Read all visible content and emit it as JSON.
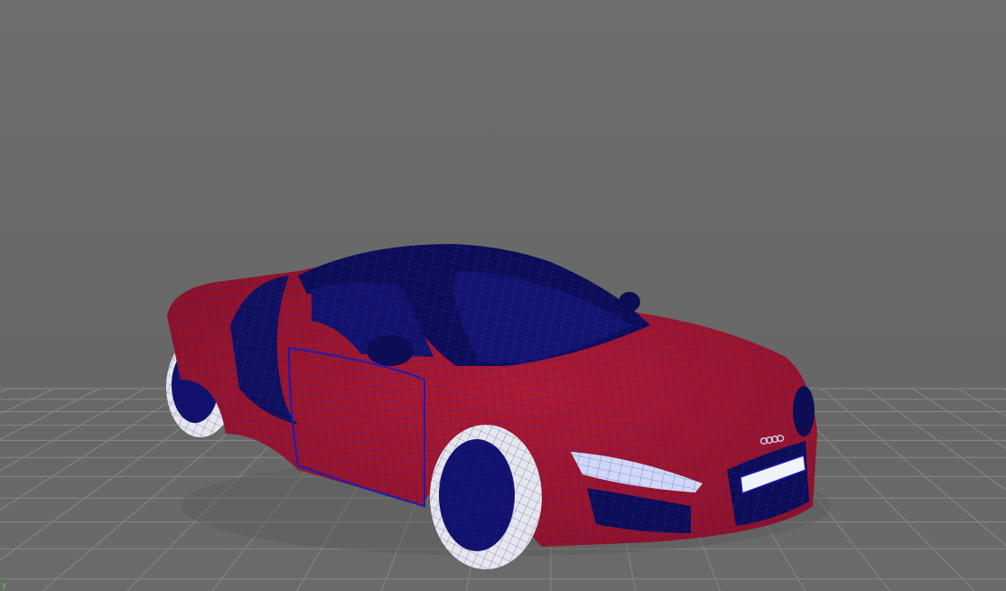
{
  "viewport": {
    "background_color": "#6b6b6b",
    "grid_color": "#8c8c8c",
    "model_base_color": "#a3172c",
    "wireframe_color": "#1c1cb0",
    "glass_color": "#0d0d55",
    "tire_color": "#e6e6ee",
    "rim_color": "#12126e",
    "headlight_color": "#cfd8f4"
  },
  "model": {
    "badge_icon": "four-rings-logo-icon",
    "display_mode": "wireframe-on-shaded"
  },
  "axis_indicator": {
    "label": "y"
  }
}
